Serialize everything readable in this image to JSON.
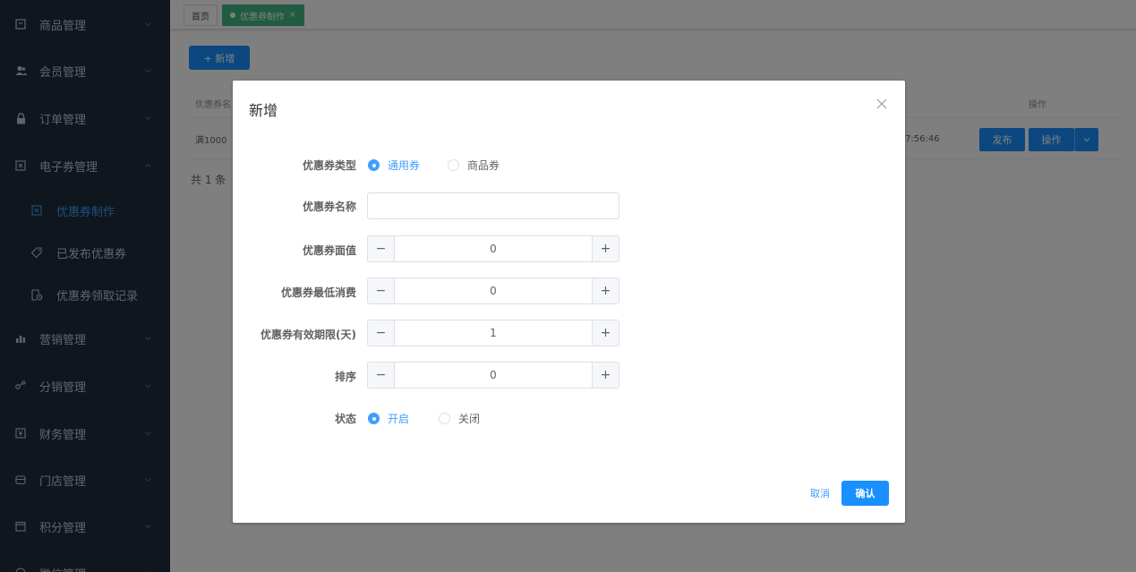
{
  "colors": {
    "sidebar_bg": "#1f2d3d",
    "sidebar_text": "#bfcbd9",
    "active": "#409eff",
    "primary_button": "#1890ff",
    "tag_active": "#42b983"
  },
  "sidebar": {
    "items": [
      {
        "label": "商品管理",
        "icon": "shopping-bag-icon"
      },
      {
        "label": "会员管理",
        "icon": "users-icon"
      },
      {
        "label": "订单管理",
        "icon": "lock-icon"
      },
      {
        "label": "电子券管理",
        "icon": "ticket-icon",
        "expanded": true
      },
      {
        "label": "营销管理",
        "icon": "chart-icon"
      },
      {
        "label": "分销管理",
        "icon": "share-icon"
      },
      {
        "label": "财务管理",
        "icon": "money-icon"
      },
      {
        "label": "门店管理",
        "icon": "store-icon"
      },
      {
        "label": "积分管理",
        "icon": "calendar-icon"
      },
      {
        "label": "微信管理",
        "icon": "wechat-icon"
      }
    ],
    "subitems": [
      {
        "label": "优惠券制作",
        "icon": "coupon-icon",
        "active": true
      },
      {
        "label": "已发布优惠券",
        "icon": "tag-icon"
      },
      {
        "label": "优惠券领取记录",
        "icon": "record-icon"
      }
    ]
  },
  "tabs": {
    "home": "首页",
    "current": "优惠券制作",
    "close": "×"
  },
  "toolbar": {
    "add_label": "+ 新增"
  },
  "table": {
    "header_first": "优惠券名",
    "header_actions": "操作",
    "row_first": "满1000",
    "row_time": "7:56:46",
    "publish_label": "发布",
    "action_label": "操作"
  },
  "pagination": {
    "total": "共 1 条"
  },
  "modal": {
    "title": "新增",
    "fields": {
      "type_label": "优惠券类型",
      "type_options": [
        "通用券",
        "商品券"
      ],
      "type_selected": "通用券",
      "name_label": "优惠券名称",
      "name_value": "",
      "face_label": "优惠券面值",
      "face_value": "0",
      "min_label": "优惠券最低消费",
      "min_value": "0",
      "valid_label": "优惠券有效期限(天)",
      "valid_value": "1",
      "sort_label": "排序",
      "sort_value": "0",
      "status_label": "状态",
      "status_options": [
        "开启",
        "关闭"
      ],
      "status_selected": "开启"
    },
    "stepper_minus": "−",
    "stepper_plus": "+",
    "cancel_label": "取消",
    "ok_label": "确认"
  }
}
